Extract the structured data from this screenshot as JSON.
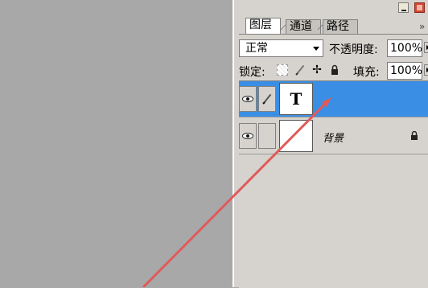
{
  "layers_panel": {
    "tabs": [
      {
        "label": "图层",
        "active": true
      },
      {
        "label": "通道",
        "active": false
      },
      {
        "label": "路径",
        "active": false
      }
    ],
    "menu_glyph": "»",
    "blend_mode": "正常",
    "opacity_label": "不透明度:",
    "opacity_value": "100%",
    "lock_label": "锁定:",
    "move_glyph": "✢",
    "fill_label": "填充:",
    "fill_value": "100%",
    "layers": [
      {
        "thumbnail_text": "T",
        "name": "",
        "selected": true,
        "type": "text"
      },
      {
        "name": "背景",
        "selected": false,
        "locked": true,
        "type": "background"
      }
    ]
  },
  "colors": {
    "canvas": "#a9a8a9",
    "panel": "#d6d3ce",
    "selected_layer": "#3a8fe4",
    "annotation_arrow": "#e05a5a"
  },
  "icons": [
    "minimize-icon",
    "close-icon",
    "eye-icon",
    "brush-icon",
    "move-icon",
    "lock-icon",
    "transparency-lock-icon"
  ]
}
